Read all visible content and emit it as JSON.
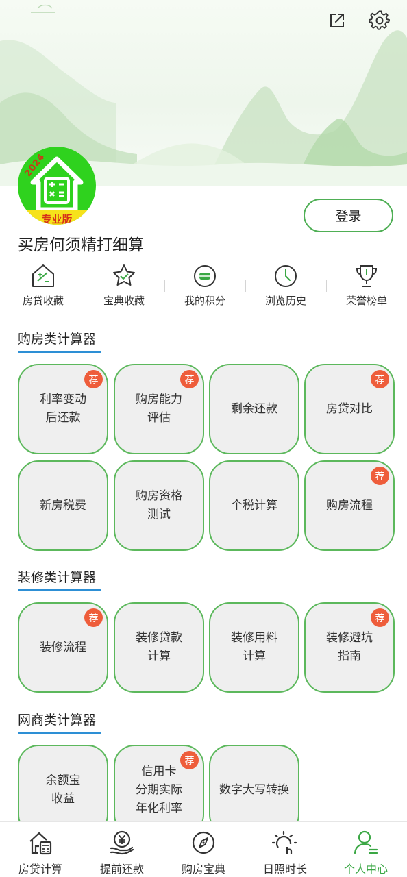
{
  "header": {
    "share_icon": "share-icon",
    "settings_icon": "gear-icon"
  },
  "logo": {
    "year": "2024",
    "ribbon": "专业版"
  },
  "login_label": "登录",
  "slogan": "买房何须精打细算",
  "quick_links": [
    {
      "label": "房贷收藏",
      "icon": "house-calc-icon"
    },
    {
      "label": "宝典收藏",
      "icon": "star-icon"
    },
    {
      "label": "我的积分",
      "icon": "coin-icon"
    },
    {
      "label": "浏览历史",
      "icon": "clock-icon"
    },
    {
      "label": "荣誉榜单",
      "icon": "trophy-icon"
    }
  ],
  "sections": [
    {
      "title": "购房类计算器",
      "tiles": [
        {
          "label": "利率变动\n后还款",
          "badge": "荐"
        },
        {
          "label": "购房能力\n评估",
          "badge": "荐"
        },
        {
          "label": "剩余还款",
          "badge": ""
        },
        {
          "label": "房贷对比",
          "badge": "荐"
        },
        {
          "label": "新房税费",
          "badge": ""
        },
        {
          "label": "购房资格\n测试",
          "badge": ""
        },
        {
          "label": "个税计算",
          "badge": ""
        },
        {
          "label": "购房流程",
          "badge": "荐"
        }
      ]
    },
    {
      "title": "装修类计算器",
      "tiles": [
        {
          "label": "装修流程",
          "badge": "荐"
        },
        {
          "label": "装修贷款\n计算",
          "badge": ""
        },
        {
          "label": "装修用料\n计算",
          "badge": ""
        },
        {
          "label": "装修避坑\n指南",
          "badge": "荐"
        }
      ]
    },
    {
      "title": "网商类计算器",
      "tiles": [
        {
          "label": "余额宝\n收益",
          "badge": ""
        },
        {
          "label": "信用卡\n分期实际\n年化利率",
          "badge": "荐"
        },
        {
          "label": "数字大写转换",
          "badge": ""
        }
      ]
    }
  ],
  "bottom_nav": [
    {
      "label": "房贷计算",
      "icon": "house-calculator-icon",
      "active": false
    },
    {
      "label": "提前还款",
      "icon": "yuan-hand-icon",
      "active": false
    },
    {
      "label": "购房宝典",
      "icon": "compass-icon",
      "active": false
    },
    {
      "label": "日照时长",
      "icon": "sun-hours-icon",
      "active": false
    },
    {
      "label": "个人中心",
      "icon": "user-icon",
      "active": true
    }
  ],
  "colors": {
    "accent_green": "#3aa744",
    "tile_border": "#5cb85c",
    "badge": "#ee5d3b",
    "section_underline": "#2d8fd5"
  }
}
